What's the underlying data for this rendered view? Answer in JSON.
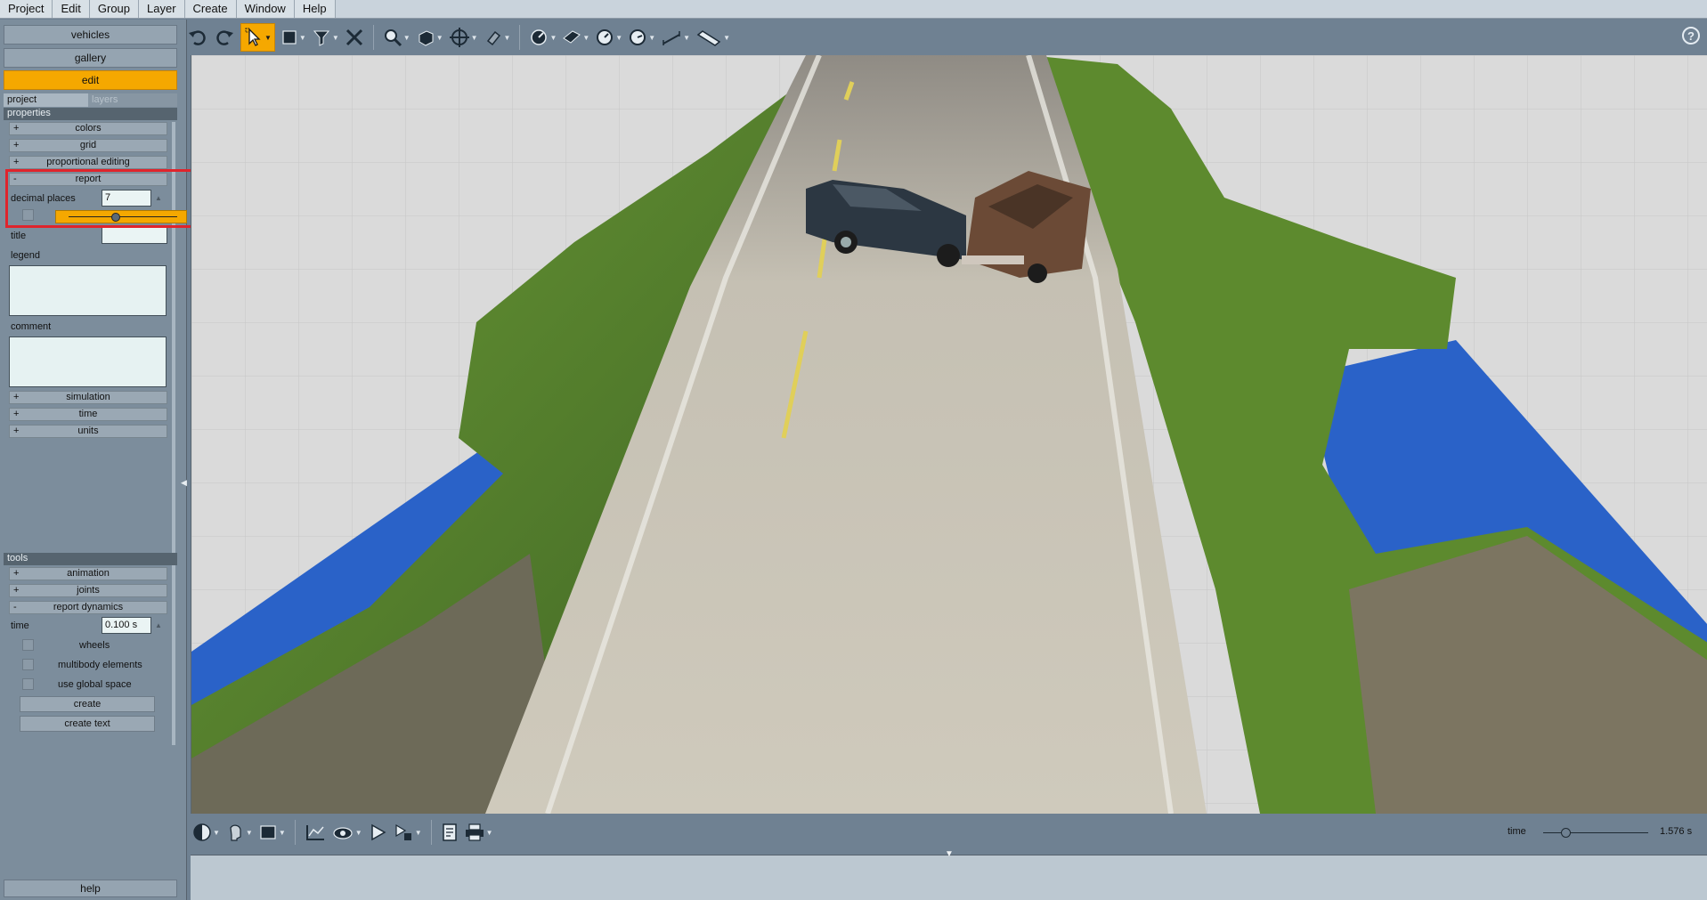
{
  "menu": [
    "Project",
    "Edit",
    "Group",
    "Layer",
    "Create",
    "Window",
    "Help"
  ],
  "toolbar": {
    "icons": [
      "undo-icon",
      "redo-icon",
      "select-arrow-icon",
      "rectangle-select-icon",
      "pin-select-icon",
      "delete-x-icon",
      "zoom-icon",
      "box-view-icon",
      "crosshair-move-icon",
      "magnet-icon",
      "measure-angle-icon",
      "plane-icon",
      "gauge-icon",
      "gauge-2-icon",
      "dimension-icon",
      "ruler-icon"
    ],
    "help": "?"
  },
  "left_panel": {
    "nav": {
      "vehicles": "vehicles",
      "gallery": "gallery",
      "edit": "edit"
    },
    "subtabs": {
      "project": "project",
      "layers": "layers"
    },
    "properties_header": "properties",
    "groups_top": {
      "colors": "colors",
      "grid": "grid",
      "proportional": "proportional editing",
      "report": "report"
    },
    "signs": {
      "plus": "+",
      "minus": "-"
    },
    "report": {
      "decimal_label": "decimal places",
      "decimal_value": "7",
      "title_label": "title",
      "title_value": "",
      "legend_label": "legend",
      "comment_label": "comment"
    },
    "groups_mid": {
      "simulation": "simulation",
      "time": "time",
      "units": "units"
    },
    "tools_header": "tools",
    "groups_tools": {
      "animation": "animation",
      "joints": "joints",
      "report_dynamics": "report dynamics"
    },
    "dynamics": {
      "time_label": "time",
      "time_value": "0.100 s",
      "wheels": "wheels",
      "multibody": "multibody elements",
      "global_space": "use global space",
      "create": "create",
      "create_text": "create text"
    },
    "help": "help"
  },
  "timeline": {
    "label": "time",
    "value": "1.576 s",
    "position": 0.22
  },
  "colors": {
    "accent": "#f5a800",
    "highlight": "#e0242c",
    "water": "#2a62c8",
    "grass": "#5a8a2c",
    "road": "#c9c4b6"
  }
}
